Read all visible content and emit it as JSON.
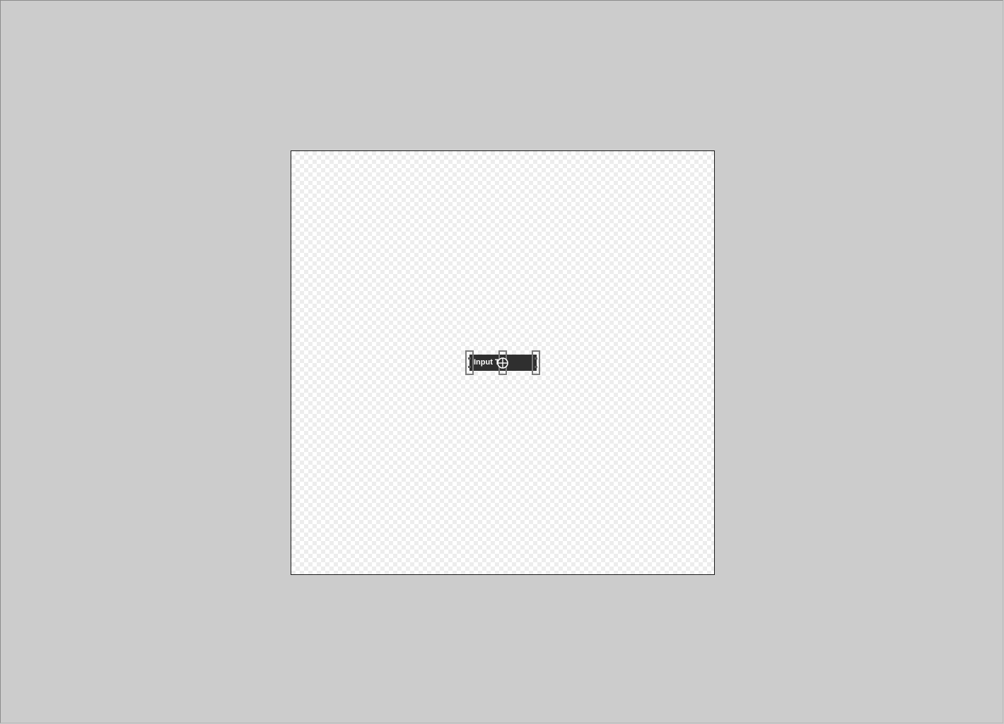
{
  "editor": {
    "canvas_background": "#cccccc",
    "artboard": {
      "background": "transparent-checkerboard",
      "border_color": "#1a1a1a"
    },
    "selected_element": {
      "type": "text-input",
      "text": "Input T",
      "fill_color": "#2f2f2f",
      "text_color": "#ffffff"
    },
    "icons": {
      "pivot": "crosshair-icon",
      "handles": [
        "resize-handle-left",
        "move-handle-center",
        "resize-handle-right"
      ]
    }
  }
}
